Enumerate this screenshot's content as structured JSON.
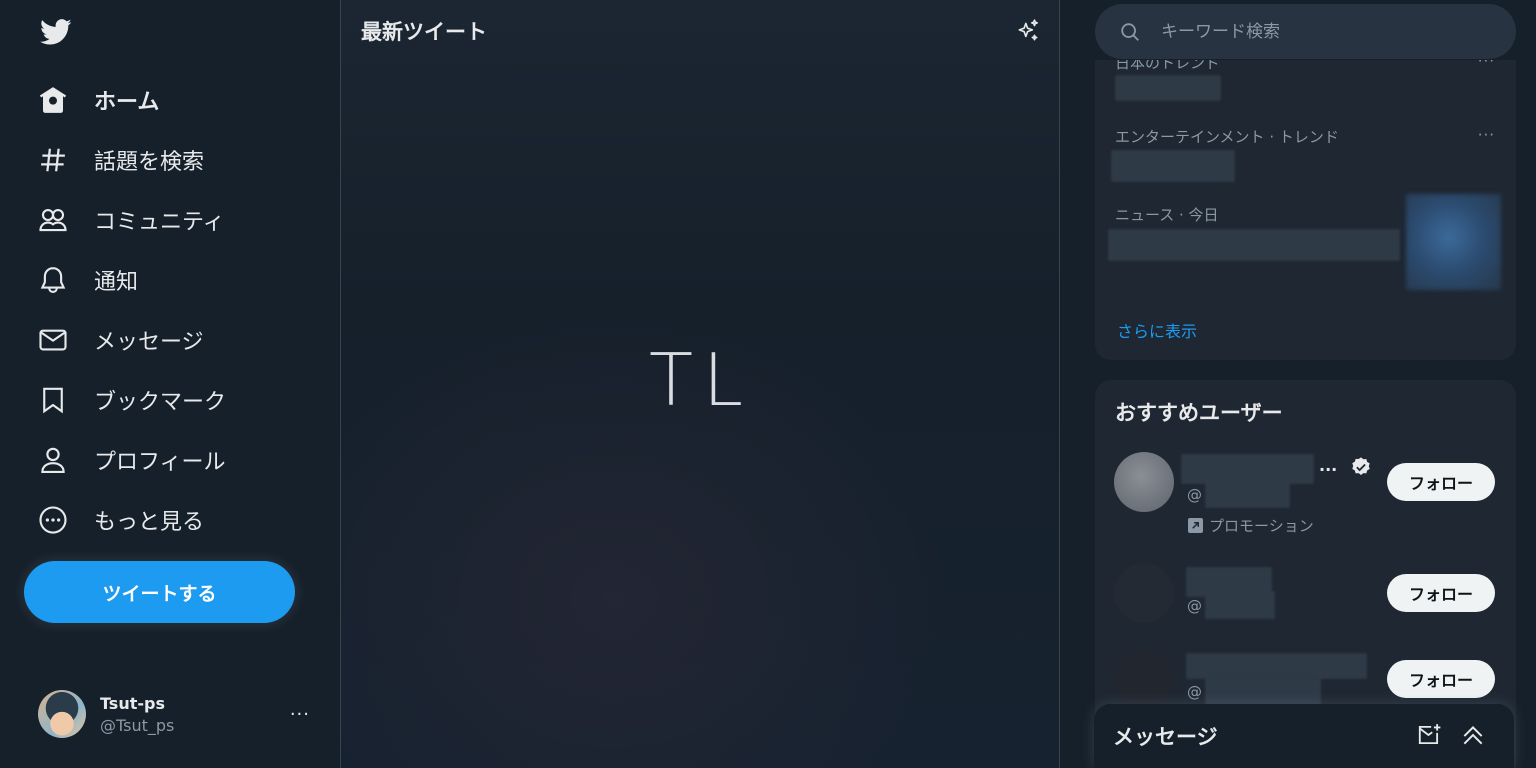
{
  "sidebar": {
    "logo_icon": "twitter-bird-icon",
    "nav": [
      {
        "label": "ホーム",
        "icon": "home-icon",
        "active": true
      },
      {
        "label": "話題を検索",
        "icon": "hashtag-icon"
      },
      {
        "label": "コミュニティ",
        "icon": "communities-icon"
      },
      {
        "label": "通知",
        "icon": "bell-icon"
      },
      {
        "label": "メッセージ",
        "icon": "envelope-icon"
      },
      {
        "label": "ブックマーク",
        "icon": "bookmark-icon"
      },
      {
        "label": "プロフィール",
        "icon": "profile-icon"
      },
      {
        "label": "もっと見る",
        "icon": "more-circle-icon"
      }
    ],
    "tweet_button": "ツイートする",
    "account": {
      "name": "Tsut-ps",
      "handle": "@Tsut_ps",
      "more": "···"
    }
  },
  "main": {
    "title": "最新ツイート",
    "placeholder_text": "TL"
  },
  "search": {
    "placeholder": "キーワード検索"
  },
  "trends": {
    "items": [
      {
        "category": "日本のトレンド",
        "more": "···"
      },
      {
        "category": "エンターテインメント · トレンド",
        "more": "···"
      },
      {
        "category": "ニュース · 今日"
      }
    ],
    "show_more": "さらに表示"
  },
  "who_to_follow": {
    "title": "おすすめユーザー",
    "users": [
      {
        "handle_prefix": "@",
        "follow_label": "フォロー",
        "promoted_label": "プロモーション",
        "truncation": "...",
        "verified": true
      },
      {
        "handle_prefix": "@",
        "follow_label": "フォロー"
      },
      {
        "handle_prefix": "@",
        "follow_label": "フォロー"
      }
    ]
  },
  "messages_drawer": {
    "title": "メッセージ"
  },
  "colors": {
    "accent": "#1d9bf0",
    "background": "#15202b",
    "card": "#1e2732",
    "secondary_text": "#8b98a5"
  }
}
